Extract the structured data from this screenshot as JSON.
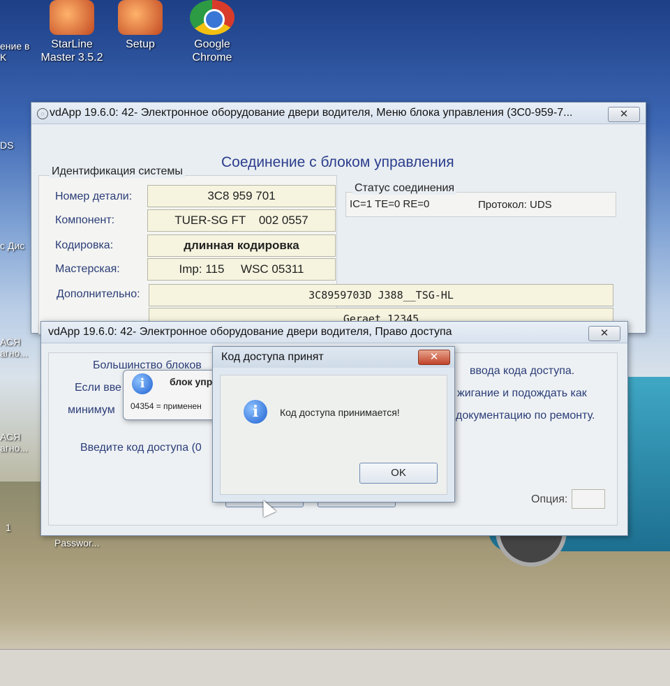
{
  "desktop": {
    "icons": [
      {
        "label": "StarLine\nMaster 3.5.2"
      },
      {
        "label": "Setup"
      },
      {
        "label": "Google\nChrome"
      }
    ],
    "left_fragment_top": "ение в\nK",
    "left_fragment_uds": "DS",
    "left_fragment_dis": "с Дис",
    "left_fragment_vasya1": "АСЯ\nагно...",
    "left_fragment_vasya2": "АСЯ\nагно...",
    "left_fragment_one": "1",
    "bottom_fragment": "Passwor..."
  },
  "main_window": {
    "title": "vdApp 19.6.0: 42- Электронное оборудование двери водителя,  Меню блока управления (3C0-959-7...",
    "close": "✕",
    "heading": "Соединение с блоком управления",
    "ident_group": "Идентификация системы",
    "part_label": "Номер детали:",
    "part_value": "3C8 959 701",
    "component_label": "Компонент:",
    "component_value": "TUER-SG FT    002 0557",
    "coding_label": "Кодировка:",
    "coding_value": "длинная кодировка",
    "workshop_label": "Мастерская:",
    "workshop_value": "Imp: 115     WSC 05311",
    "extra_label": "Дополнительно:",
    "extra_value": "3C8959703D J388__TSG-HL",
    "extra2_value": "Geraet 12345",
    "status_group": "Статус соединения",
    "status_text": "IC=1  TE=0   RE=0",
    "protocol_text": "Протокол: UDS"
  },
  "access_window": {
    "title": "vdApp 19.6.0: 42- Электронное оборудование двери водителя,  Право доступа",
    "close": "✕",
    "line1_left": "Большинство блоков",
    "line1_right": "ввода кода доступа.",
    "line2_left": "Если вве",
    "line2_right": "жигание и подождать как",
    "line3_left": "минимум",
    "line3_right": "документацию по ремонту.",
    "enter_code": "Введите код доступа (0",
    "option_label": "Опция:"
  },
  "hint_popup": {
    "title": "блок упр",
    "subtext": "04354 = применен"
  },
  "dialog": {
    "title": "Код доступа принят",
    "close": "✕",
    "message": "Код доступа принимается!",
    "ok": "OK"
  }
}
